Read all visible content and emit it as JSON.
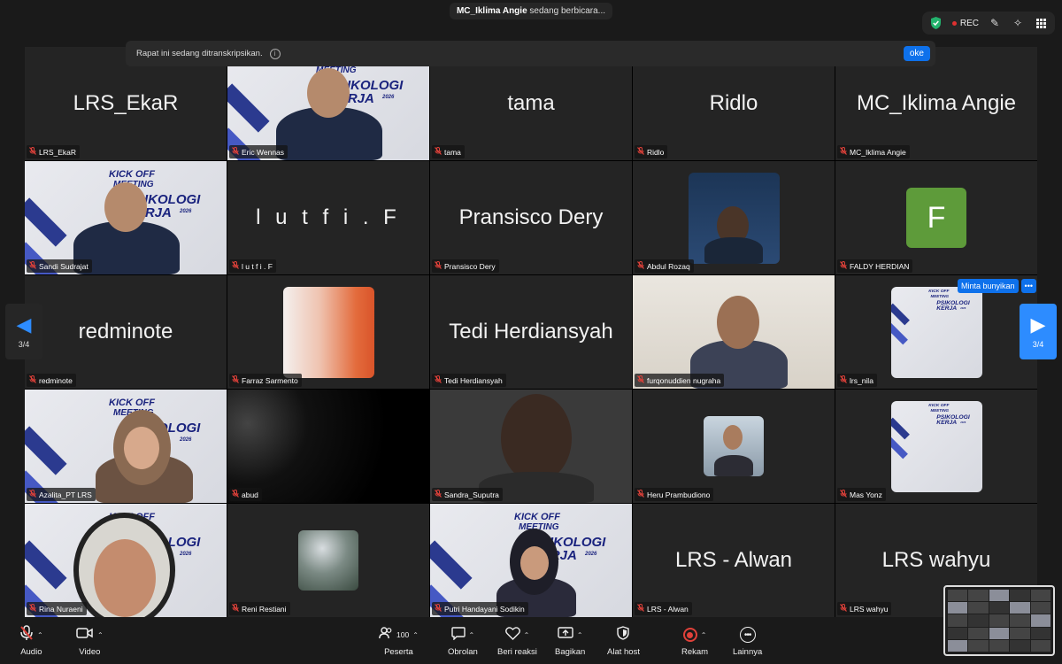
{
  "speaking": {
    "name": "MC_Iklima Angie",
    "suffix": " sedang berbicara..."
  },
  "top_right": {
    "rec_label": "REC",
    "icons": [
      "shield-check-icon",
      "pencil-icon",
      "sparkle-icon",
      "grid-view-icon"
    ]
  },
  "banner": {
    "text": "Rapat ini sedang ditranskripsikan.",
    "info": "i",
    "ok_label": "oke"
  },
  "slide_text": {
    "line1": "KICK OFF",
    "line2": "MEETING",
    "line3": "PSIKOLOGI KERJA",
    "year": "2026"
  },
  "tiles": [
    {
      "name": "LRS_EkaR",
      "display": "LRS_EkaR",
      "kind": "name"
    },
    {
      "name": "Eric Wennas",
      "display": "",
      "kind": "video-banner"
    },
    {
      "name": "tama",
      "display": "tama",
      "kind": "name"
    },
    {
      "name": "Ridlo",
      "display": "Ridlo",
      "kind": "name"
    },
    {
      "name": "MC_Iklima Angie",
      "display": "MC_Iklima Angie",
      "kind": "name"
    },
    {
      "name": "Sandi Sudrajat",
      "display": "",
      "kind": "video-banner"
    },
    {
      "name": "l u t f i . F",
      "display": "l u t f i . F",
      "kind": "name"
    },
    {
      "name": "Pransisco Dery",
      "display": "Pransisco Dery",
      "kind": "name"
    },
    {
      "name": "Abdul Rozaq",
      "display": "",
      "kind": "thumb"
    },
    {
      "name": "FALDY HERDIAN",
      "display": "F",
      "kind": "avatar"
    },
    {
      "name": "redminote",
      "display": "redminote",
      "kind": "name"
    },
    {
      "name": "Farraz Sarmento",
      "display": "",
      "kind": "thumb"
    },
    {
      "name": "Tedi Herdiansyah",
      "display": "Tedi Herdiansyah",
      "kind": "name"
    },
    {
      "name": "furqonuddien nugraha",
      "display": "",
      "kind": "video"
    },
    {
      "name": "lrs_nila",
      "display": "",
      "kind": "thumb-banner"
    },
    {
      "name": "Azalita_PT LRS",
      "display": "",
      "kind": "video-banner"
    },
    {
      "name": "abud",
      "display": "",
      "kind": "video-dark"
    },
    {
      "name": "Sandra_Suputra",
      "display": "",
      "kind": "video"
    },
    {
      "name": "Heru Prambudiono",
      "display": "",
      "kind": "thumb"
    },
    {
      "name": "Mas Yonz",
      "display": "",
      "kind": "thumb-banner"
    },
    {
      "name": "Rina Nuraeni",
      "display": "",
      "kind": "video"
    },
    {
      "name": "Reni Restiani",
      "display": "",
      "kind": "thumb"
    },
    {
      "name": "Putri Handayani Sodikin",
      "display": "",
      "kind": "video-banner"
    },
    {
      "name": "LRS - Alwan",
      "display": "LRS - Alwan",
      "kind": "name"
    },
    {
      "name": "LRS wahyu",
      "display": "LRS wahyu",
      "kind": "name"
    }
  ],
  "minta": {
    "label": "Minta bunyikan",
    "more": "•••"
  },
  "pagination": {
    "left_page": "3/4",
    "right_page": "3/4"
  },
  "toolbar": {
    "audio": "Audio",
    "video": "Video",
    "participants": "Peserta",
    "participants_count": "100",
    "chat": "Obrolan",
    "reactions": "Beri reaksi",
    "share": "Bagikan",
    "host_tools": "Alat host",
    "record": "Rekam",
    "more": "Lainnya"
  },
  "colors": {
    "accent": "#0e71eb",
    "mute": "#e0413a",
    "avatar": "#5e9b3a",
    "banner_navy": "#1a237e"
  }
}
